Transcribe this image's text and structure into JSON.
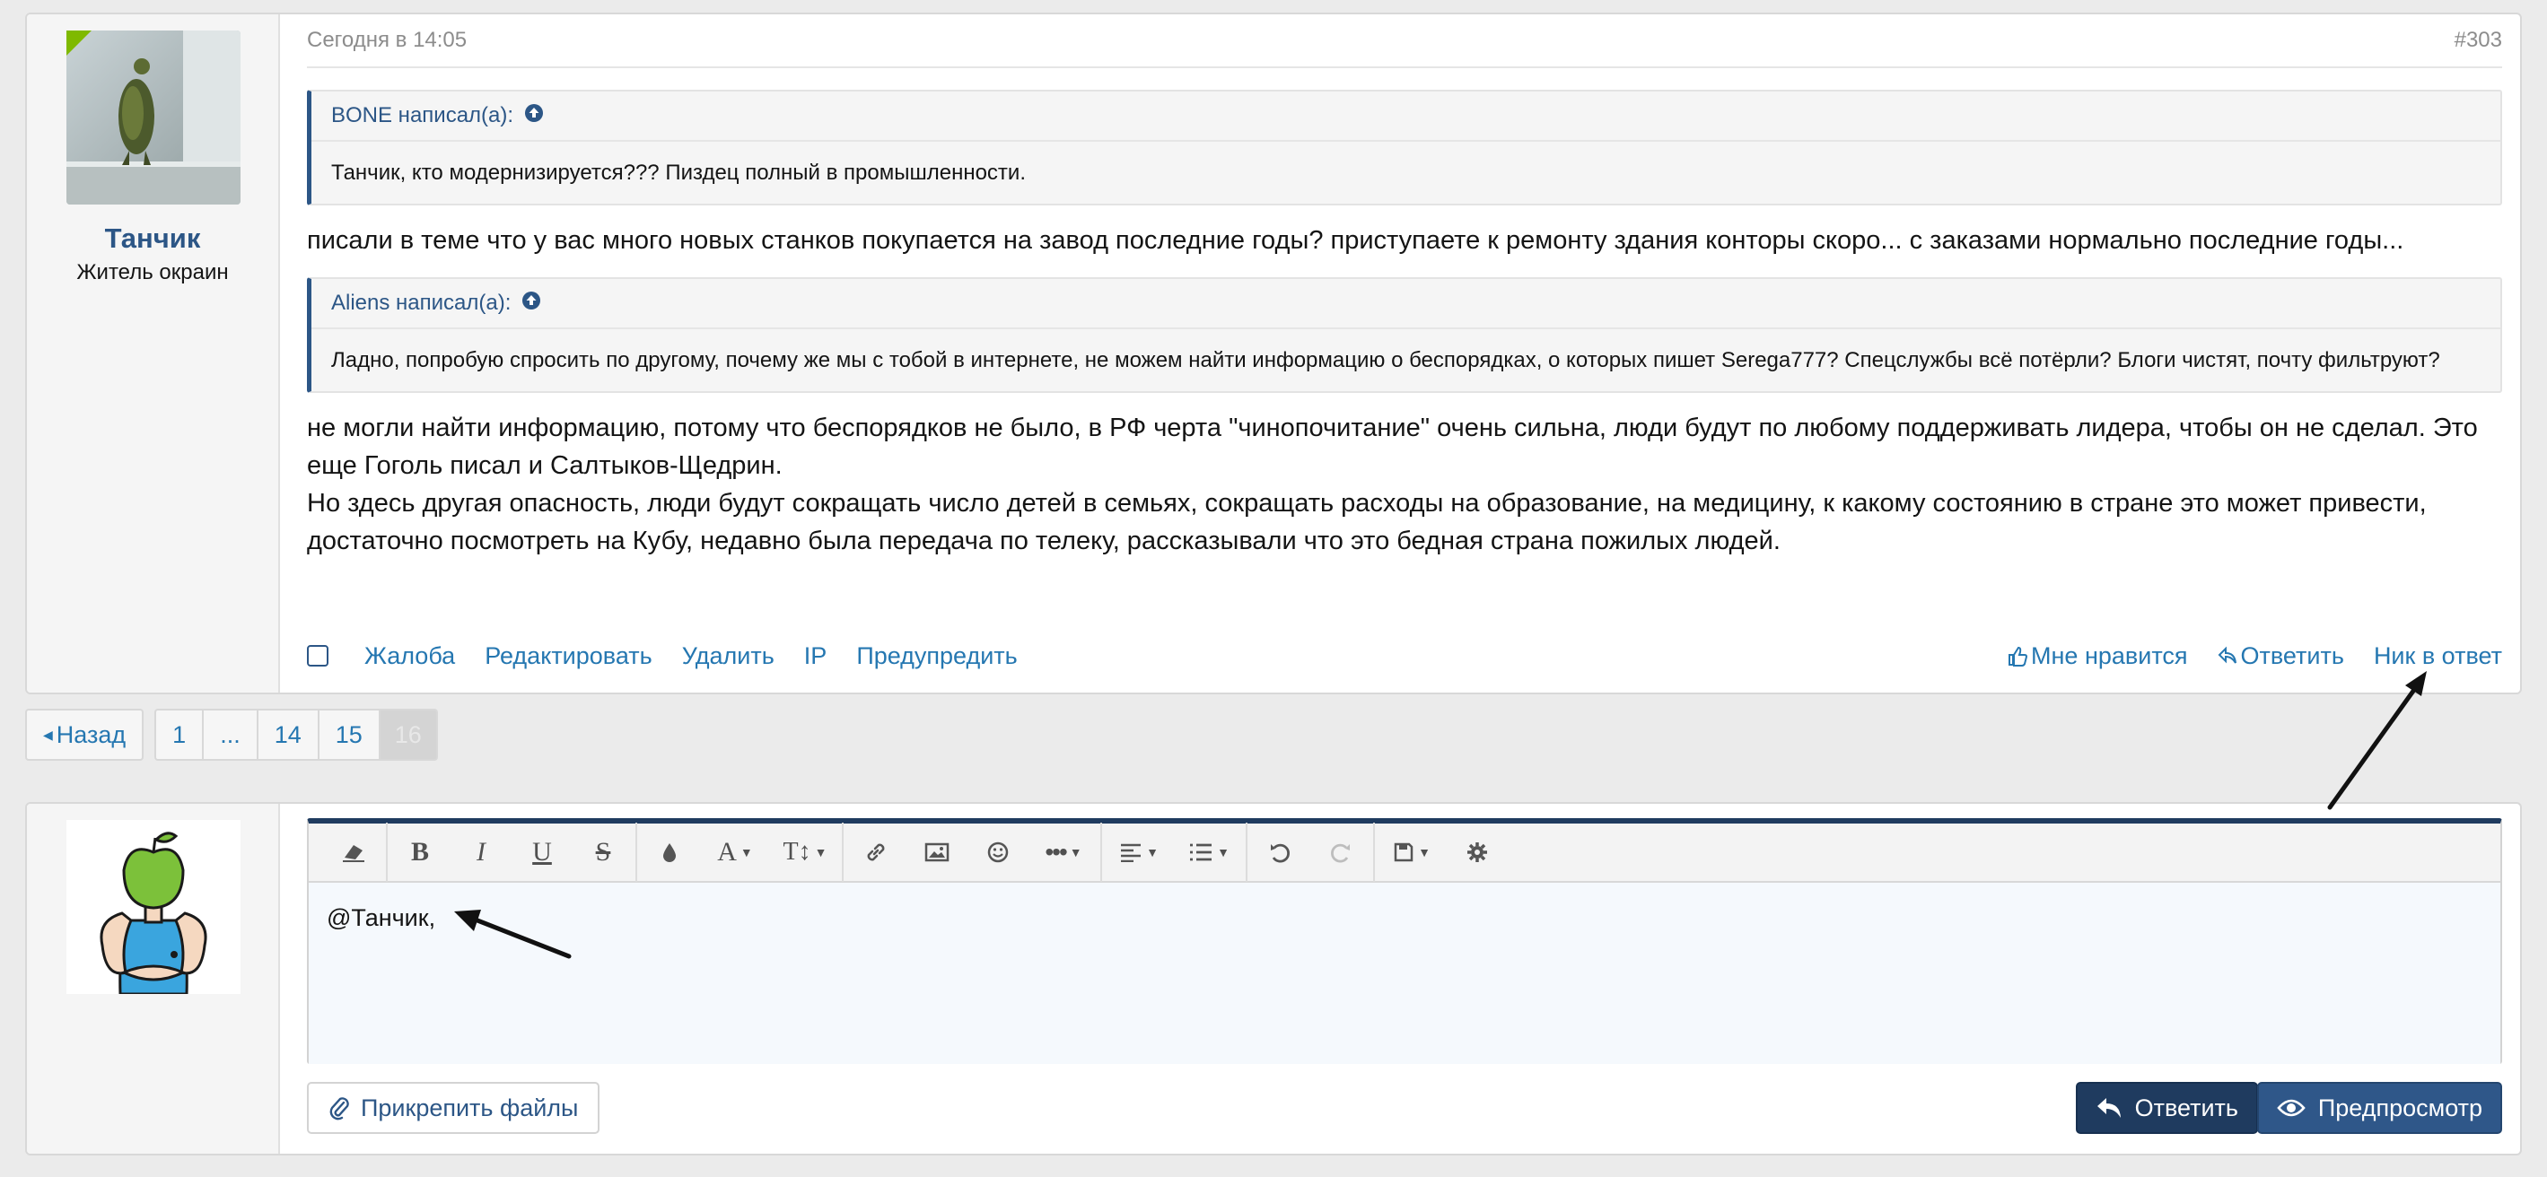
{
  "post": {
    "author": {
      "name": "Танчик",
      "title": "Житель окраин"
    },
    "date": "Сегодня в 14:05",
    "number": "#303",
    "quote1": {
      "author": "BONE написал(а):",
      "text": "Танчик, кто модернизируется??? Пиздец полный в промышленности."
    },
    "text1": "писали в теме что у вас много новых станков покупается на завод последние годы? приступаете к ремонту здания конторы скоро... с заказами нормально последние годы...",
    "quote2": {
      "author": "Aliens написал(а):",
      "text": "Ладно, попробую спросить по другому, почему же мы с тобой в интернете, не можем найти информацию о беспорядках, о которых пишет Serega777? Спецслужбы всё потёрли? Блоги чистят, почту фильтруют?"
    },
    "text2a": "не могли найти информацию, потому что беспорядков не было, в РФ черта \"чинопочитание\" очень сильна, люди будут по любому поддерживать лидера, чтобы он не сделал. Это еще Гоголь писал и Салтыков-Щедрин.",
    "text2b": "Но здесь другая опасность, люди будут сокращать число детей в семьях, сокращать расходы на образование, на медицину, к какому состоянию в стране это может привести, достаточно посмотреть на Кубу, недавно была передача по телеку, рассказывали что это бедная страна пожилых людей.",
    "actions": {
      "report": "Жалоба",
      "edit": "Редактировать",
      "delete": "Удалить",
      "ip": "IP",
      "warn": "Предупредить",
      "like": "Мне нравится",
      "reply": "Ответить",
      "nick_reply": "Ник в ответ"
    }
  },
  "pagination": {
    "back": "Назад",
    "pages": [
      "1",
      "...",
      "14",
      "15",
      "16"
    ],
    "current": "16"
  },
  "reply_form": {
    "editor_text": "@Танчик,",
    "attach_label": "Прикрепить файлы",
    "submit_label": "Ответить",
    "preview_label": "Предпросмотр",
    "toolbar": [
      "eraser-icon",
      "bold-icon",
      "italic-icon",
      "underline-icon",
      "strikethrough-icon",
      "color-icon",
      "font-family-icon",
      "font-size-icon",
      "link-icon",
      "image-icon",
      "smiley-icon",
      "more-icon",
      "align-icon",
      "list-icon",
      "undo-icon",
      "redo-icon",
      "save-draft-icon",
      "settings-icon"
    ]
  },
  "colors": {
    "accent": "#2c5686",
    "link": "#2577b1",
    "online": "#7fb900",
    "button_dark": "#1f3b5f"
  }
}
